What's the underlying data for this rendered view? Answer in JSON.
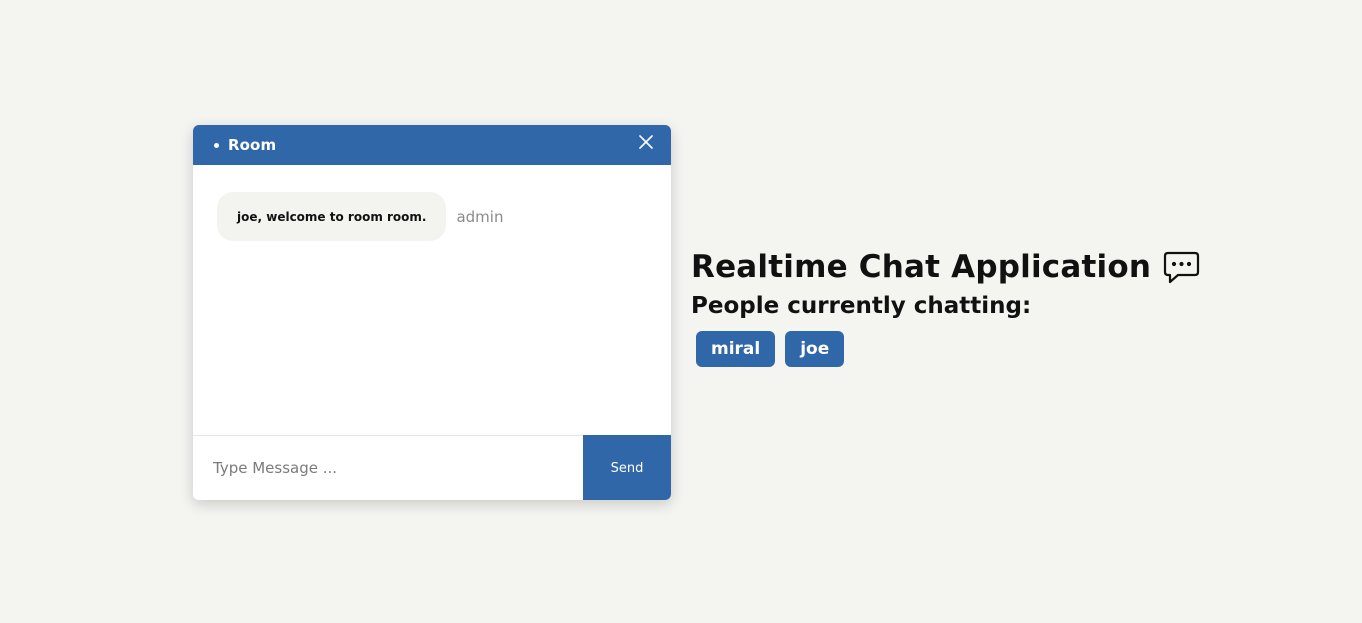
{
  "chat": {
    "room_name": "Room",
    "messages": [
      {
        "text": "joe, welcome to room room.",
        "sender": "admin"
      }
    ],
    "input_placeholder": "Type Message ...",
    "input_value": "",
    "send_label": "Send",
    "close_icon": "close-icon"
  },
  "info": {
    "title": "Realtime Chat Application",
    "title_icon": "chat-bubble-icon",
    "people_heading": "People currently chatting:",
    "users": [
      "miral",
      "joe"
    ]
  },
  "colors": {
    "accent": "#3067a8",
    "background": "#f4f4f1",
    "bubble": "#f3f3f0"
  }
}
